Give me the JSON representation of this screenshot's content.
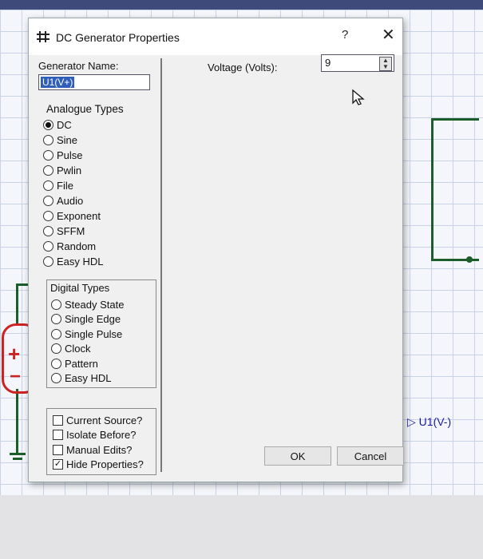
{
  "dialog": {
    "title": "DC Generator Properties",
    "help_glyph": "?",
    "close_glyph": "✕"
  },
  "generator": {
    "name_label": "Generator Name:",
    "name_value": "U1(V+)"
  },
  "voltage": {
    "label": "Voltage (Volts):",
    "value": "9"
  },
  "analogue": {
    "heading": "Analogue Types",
    "options": [
      "DC",
      "Sine",
      "Pulse",
      "Pwlin",
      "File",
      "Audio",
      "Exponent",
      "SFFM",
      "Random",
      "Easy HDL"
    ],
    "selected": "DC"
  },
  "digital": {
    "heading": "Digital Types",
    "options": [
      "Steady State",
      "Single Edge",
      "Single Pulse",
      "Clock",
      "Pattern",
      "Easy HDL"
    ]
  },
  "checkboxes": [
    {
      "label": "Current Source?",
      "checked": false
    },
    {
      "label": "Isolate Before?",
      "checked": false
    },
    {
      "label": "Manual Edits?",
      "checked": false
    },
    {
      "label": "Hide Properties?",
      "checked": true
    }
  ],
  "buttons": {
    "ok": "OK",
    "cancel": "Cancel"
  },
  "schematic": {
    "probe_label": "U1(V-)",
    "battery_plus": "+",
    "battery_minus": "−"
  },
  "colors": {
    "wire": "#1b5e2a",
    "battery": "#cc2222",
    "probe": "#1a1a99",
    "selection": "#2f5fb8"
  }
}
